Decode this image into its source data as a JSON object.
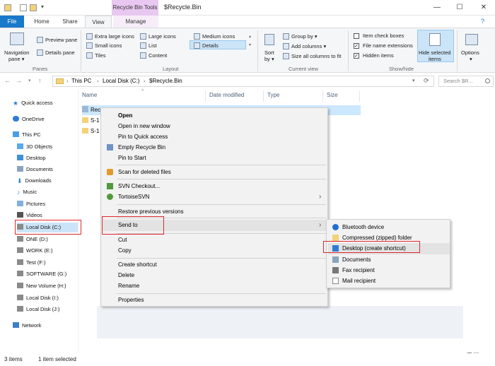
{
  "window": {
    "title": "$Recycle.Bin",
    "contextual_tab": "Recycle Bin Tools",
    "controls": {
      "minimize": "—",
      "maximize": "☐",
      "close": "✕"
    }
  },
  "tabs": [
    "File",
    "Home",
    "Share",
    "View",
    "Manage"
  ],
  "ribbon": {
    "panes": {
      "navigation_pane": "Navigation",
      "navigation_pane_2": "pane ▾",
      "preview_pane": "Preview pane",
      "details_pane": "Details pane",
      "group": "Panes"
    },
    "layout": {
      "extra_large": "Extra large icons",
      "large": "Large icons",
      "medium": "Medium icons",
      "small": "Small icons",
      "list": "List",
      "details": "Details",
      "tiles": "Tiles",
      "content": "Content",
      "group": "Layout"
    },
    "current_view": {
      "sort_by": "Sort",
      "sort_by_2": "by ▾",
      "group_by": "Group by ▾",
      "add_columns": "Add columns ▾",
      "size_all": "Size all columns to fit",
      "group": "Current view"
    },
    "show_hide": {
      "item_checkboxes": "Item check boxes",
      "file_ext": "File name extensions",
      "hidden_items": "Hidden items",
      "hide_selected": "Hide selected",
      "hide_selected_2": "items",
      "group": "Show/hide"
    },
    "options": {
      "label": "Options",
      "label_2": "▾"
    }
  },
  "address": {
    "breadcrumb": [
      "This PC",
      "Local Disk (C:)",
      "$Recycle.Bin"
    ],
    "separator": "›",
    "search_placeholder": "Search $R...",
    "nav": {
      "back": "←",
      "forward": "→",
      "up": "↑",
      "dropdown": "▾",
      "refresh": "⟳"
    }
  },
  "sidebar": {
    "items": [
      {
        "label": "Quick access",
        "icon": "star-icon",
        "color": "#2f7bd6"
      },
      {
        "label": "OneDrive",
        "icon": "cloud-icon",
        "color": "#2f7bd6"
      },
      {
        "label": "This PC",
        "icon": "computer-icon",
        "color": "#4a9ee6"
      },
      {
        "label": "3D Objects",
        "icon": "cube-icon",
        "color": "#5aa9f0"
      },
      {
        "label": "Desktop",
        "icon": "desktop-icon",
        "color": "#3f8fdc"
      },
      {
        "label": "Documents",
        "icon": "document-icon",
        "color": "#8aa4c0"
      },
      {
        "label": "Downloads",
        "icon": "download-icon",
        "color": "#2f7bd6"
      },
      {
        "label": "Music",
        "icon": "music-icon",
        "color": "#4a8fd8"
      },
      {
        "label": "Pictures",
        "icon": "picture-icon",
        "color": "#7fb1e0"
      },
      {
        "label": "Videos",
        "icon": "video-icon",
        "color": "#555555"
      },
      {
        "label": "Local Disk (C:)",
        "icon": "drive-icon",
        "color": "#8a8a8a"
      },
      {
        "label": "ONE (D:)",
        "icon": "drive-icon",
        "color": "#8a8a8a"
      },
      {
        "label": "WORK (E:)",
        "icon": "drive-icon",
        "color": "#8a8a8a"
      },
      {
        "label": "Test (F:)",
        "icon": "drive-icon",
        "color": "#8a8a8a"
      },
      {
        "label": "SOFTWARE (G:)",
        "icon": "drive-icon",
        "color": "#8a8a8a"
      },
      {
        "label": "New Volume (H:)",
        "icon": "drive-icon",
        "color": "#8a8a8a"
      },
      {
        "label": "Local Disk (I:)",
        "icon": "drive-icon",
        "color": "#8a8a8a"
      },
      {
        "label": "Local Disk (J:)",
        "icon": "drive-icon",
        "color": "#8a8a8a"
      },
      {
        "label": "Network",
        "icon": "network-icon",
        "color": "#3f7fc9"
      }
    ]
  },
  "file_list": {
    "columns": [
      "Name",
      "Date modified",
      "Type",
      "Size"
    ],
    "rows": [
      "Rec",
      "S-1",
      "S-1"
    ]
  },
  "context_menu": {
    "items": [
      "Open",
      "Open in new window",
      "Pin to Quick access",
      "Empty Recycle Bin",
      "Pin to Start",
      "Scan for deleted files",
      "SVN Checkout...",
      "TortoiseSVN",
      "Restore previous versions",
      "Send to",
      "Cut",
      "Copy",
      "Create shortcut",
      "Delete",
      "Rename",
      "Properties"
    ],
    "submenu_arrow": "›"
  },
  "send_to_menu": {
    "items": [
      "Bluetooth device",
      "Compressed (zipped) folder",
      "Desktop (create shortcut)",
      "Documents",
      "Fax recipient",
      "Mail recipient"
    ]
  },
  "status_bar": {
    "items_count": "3 items",
    "selected": "1 item selected"
  },
  "colors": {
    "accent": "#1979ca",
    "highlight": "#cce4f7",
    "callout": "#e0282e",
    "contextual_tab": "#e8c8f0"
  }
}
